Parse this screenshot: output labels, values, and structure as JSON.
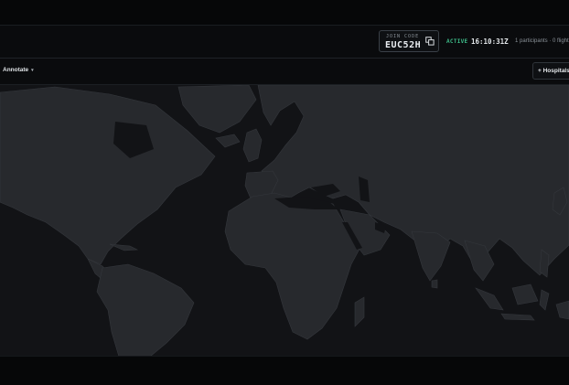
{
  "session": {
    "join_label": "JOIN CODE",
    "join_code": "EUC52H",
    "status": "ACTIVE",
    "clock": "16:10:31Z",
    "meta": "1 participants · 0 flight"
  },
  "toolbar": {
    "annotate_label": "Annotate",
    "annotate_caret": "▾",
    "add_label": "+ Hospitals"
  },
  "colors": {
    "ocean": "#121316",
    "land": "#27292d",
    "land_border": "#34373c",
    "accent_active": "#3dbb88"
  }
}
